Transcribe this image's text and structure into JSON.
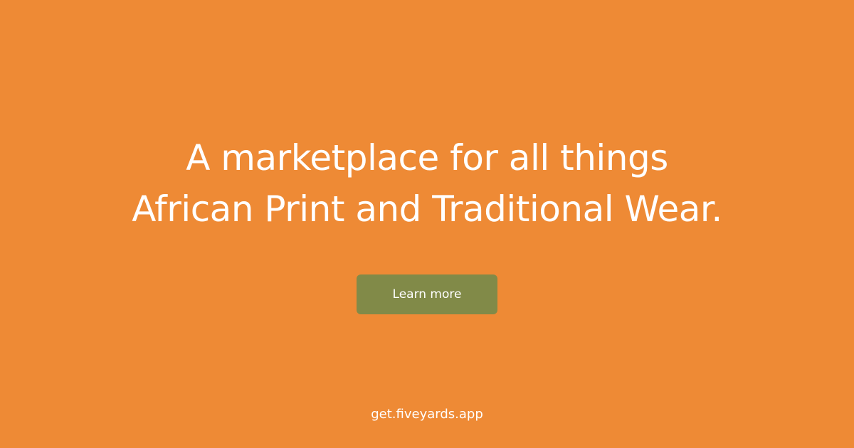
{
  "colors": {
    "background": "#ee8a35",
    "button_background": "#818a48",
    "text": "#ffffff"
  },
  "hero": {
    "headline_line1": "A marketplace for all things",
    "headline_line2": "African Print and Traditional Wear."
  },
  "cta": {
    "label": "Learn more"
  },
  "footer": {
    "url": "get.fiveyards.app"
  }
}
